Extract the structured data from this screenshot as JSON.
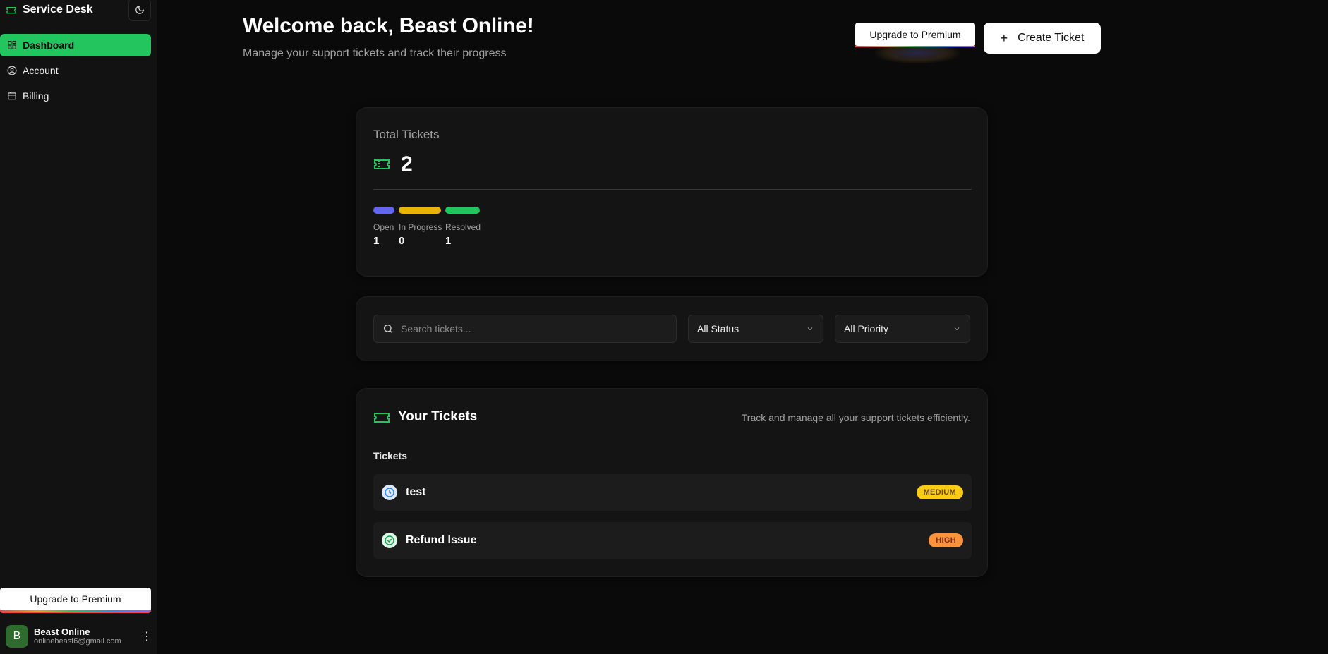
{
  "sidebar": {
    "brand": "Service Desk",
    "items": [
      {
        "label": "Dashboard",
        "icon": "dashboard-icon",
        "active": true
      },
      {
        "label": "Account",
        "icon": "user-circle-icon",
        "active": false
      },
      {
        "label": "Billing",
        "icon": "billing-icon",
        "active": false
      }
    ],
    "upgrade_label": "Upgrade to Premium",
    "user": {
      "initial": "B",
      "name": "Beast Online",
      "email": "onlinebeast6@gmail.com"
    }
  },
  "header": {
    "title": "Welcome back, Beast Online!",
    "subtitle": "Manage your support tickets and track their progress",
    "upgrade_label": "Upgrade to Premium",
    "create_label": "Create Ticket",
    "create_icon": "+"
  },
  "stats": {
    "label": "Total Tickets",
    "total": "2",
    "statuses": [
      {
        "label": "Open",
        "value": "1",
        "color": "#6366f1"
      },
      {
        "label": "In Progress",
        "value": "0",
        "color": "#eab308"
      },
      {
        "label": "Resolved",
        "value": "1",
        "color": "#22c55e"
      }
    ]
  },
  "filters": {
    "search_placeholder": "Search tickets...",
    "status_value": "All Status",
    "priority_value": "All Priority"
  },
  "tickets": {
    "title": "Your Tickets",
    "description": "Track and manage all your support tickets efficiently.",
    "section_label": "Tickets",
    "items": [
      {
        "title": "test",
        "priority": "MEDIUM",
        "status_icon": "clock-icon"
      },
      {
        "title": "Refund Issue",
        "priority": "HIGH",
        "status_icon": "check-circle-icon"
      }
    ]
  },
  "colors": {
    "accent": "#22c55e",
    "background": "#0a0a0a",
    "card": "#141414"
  }
}
